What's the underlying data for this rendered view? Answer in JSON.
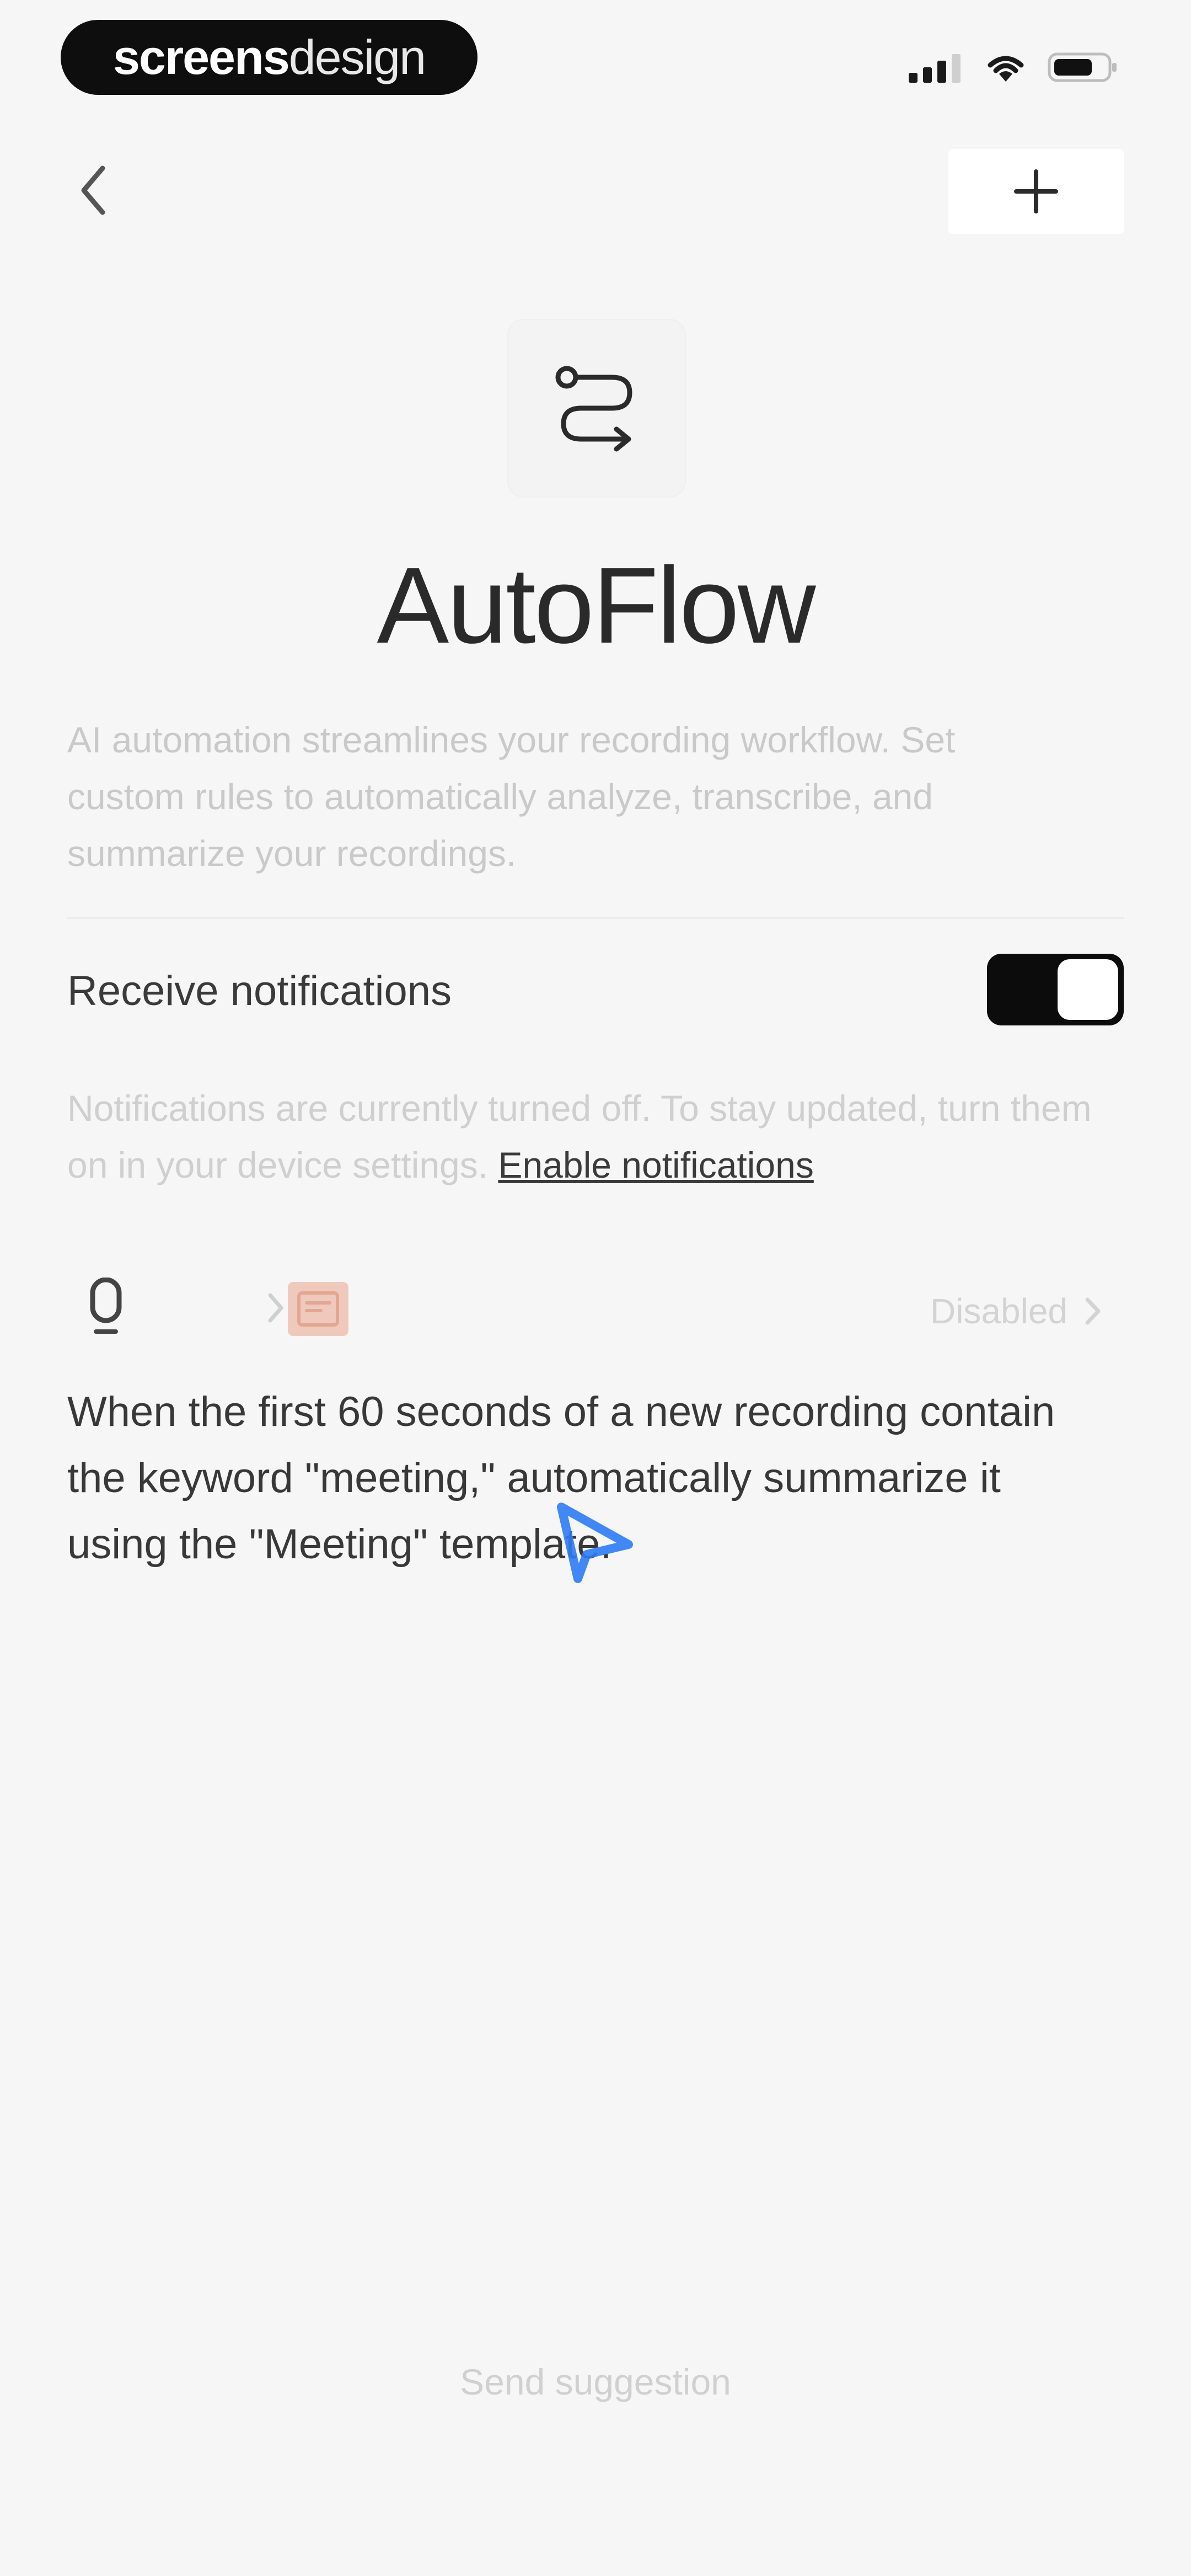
{
  "status_bar": {
    "brand_part1": "screens",
    "brand_part2": "design",
    "signal_icon": "signal-icon",
    "wifi_icon": "wifi-icon",
    "battery_icon": "battery-icon"
  },
  "nav": {
    "back_icon": "chevron-left-icon",
    "add_icon": "plus-icon"
  },
  "header": {
    "icon": "route-icon",
    "title": "AutoFlow",
    "description": "AI automation streamlines your recording workflow. Set custom rules to automatically analyze, transcribe, and summarize your recordings."
  },
  "notifications": {
    "label": "Receive notifications",
    "toggle_on": true,
    "note": "Notifications are currently turned off. To stay updated, turn them on in your device settings.",
    "link": "Enable notifications"
  },
  "rule": {
    "trigger_icon": "microphone-icon",
    "action_icon": "template-icon",
    "status": "Disabled",
    "text": "When the first 60 seconds of a new recording contain the keyword \"meeting,\" automatically summarize it using the \"Meeting\" template."
  },
  "footer": {
    "send_suggestion": "Send suggestion"
  },
  "colors": {
    "background": "#f6f6f6",
    "toggle": "#0c0c0c",
    "accent_pointer": "#2e7cf6",
    "template_icon": "#f0c9bd"
  }
}
